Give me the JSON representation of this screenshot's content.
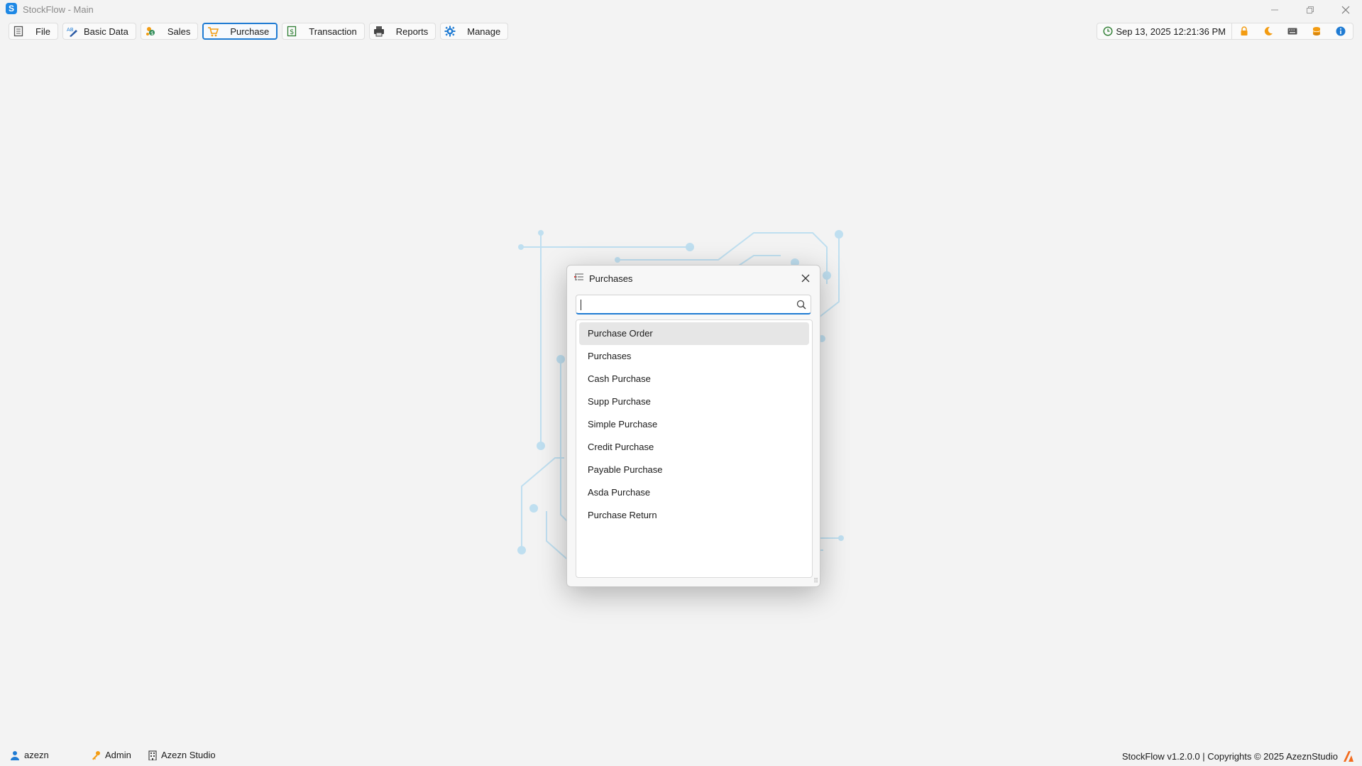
{
  "window": {
    "title": "StockFlow - Main",
    "app_icon_letter": "S"
  },
  "menu": [
    {
      "label": "File",
      "icon": "file-icon"
    },
    {
      "label": "Basic Data",
      "icon": "abc-edit-icon"
    },
    {
      "label": "Sales",
      "icon": "sales-icon"
    },
    {
      "label": "Purchase",
      "icon": "cart-icon",
      "active": true
    },
    {
      "label": "Transaction",
      "icon": "dollar-doc-icon"
    },
    {
      "label": "Reports",
      "icon": "printer-icon"
    },
    {
      "label": "Manage",
      "icon": "gear-icon"
    }
  ],
  "topbar": {
    "datetime": "Sep 13, 2025 12:21:36 PM",
    "icons": [
      "lock-icon",
      "moon-icon",
      "keyboard-icon",
      "database-icon",
      "info-icon"
    ]
  },
  "dialog": {
    "title": "Purchases",
    "search": {
      "value": "",
      "placeholder": ""
    },
    "items": [
      "Purchase Order",
      "Purchases",
      "Cash Purchase",
      "Supp Purchase",
      "Simple Purchase",
      "Credit Purchase",
      "Payable Purchase",
      "Asda Purchase",
      "Purchase Return"
    ],
    "selected_index": 0
  },
  "status": {
    "user": "azezn",
    "role": "Admin",
    "company": "Azezn Studio",
    "footer": "StockFlow v1.2.0.0 | Copyrights © 2025 AzeznStudio"
  },
  "colors": {
    "accent": "#1f7bd3",
    "orange": "#f39c12",
    "background": "#f3f3f3",
    "circuit": "#b9dcef"
  }
}
